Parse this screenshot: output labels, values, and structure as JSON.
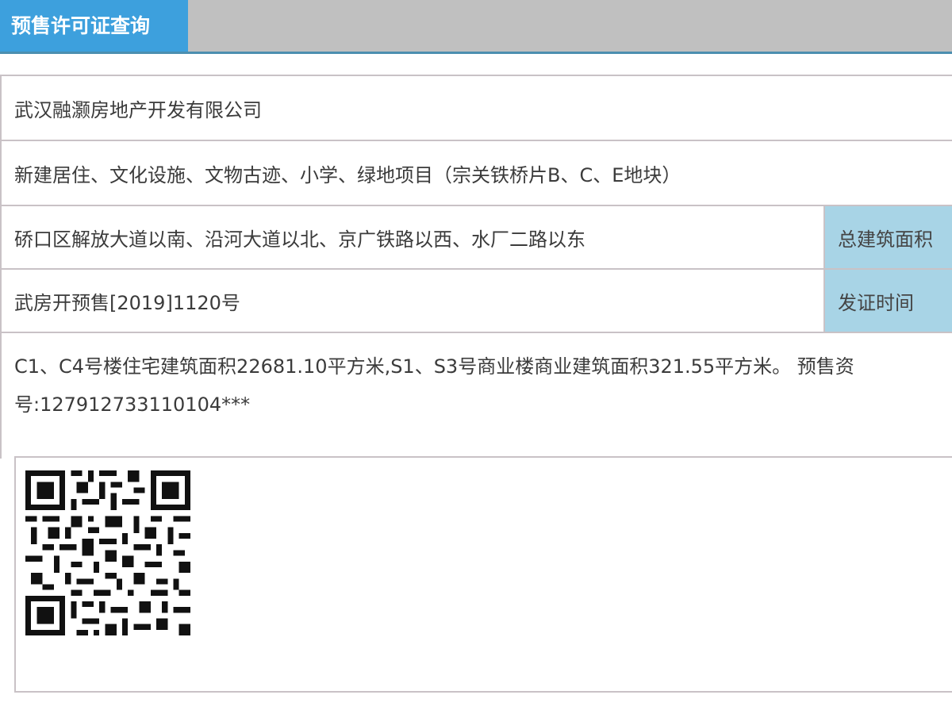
{
  "tab": {
    "title": "预售许可证查询"
  },
  "rows": {
    "company": "武汉融灏房地产开发有限公司",
    "project": "新建居住、文化设施、文物古迹、小学、绿地项目（宗关铁桥片B、C、E地块）",
    "location": "硚口区解放大道以南、沿河大道以北、京广铁路以西、水厂二路以东",
    "area_label": "总建筑面积",
    "permit_no": "武房开预售[2019]1120号",
    "issue_label": "发证时间",
    "remarks_line1": "C1、C4号楼住宅建筑面积22681.10平方米,S1、S3号商业楼商业建筑面积321.55平方米。 预售资",
    "remarks_line2": "号:127912733110104***"
  },
  "qr": {
    "icon": "qr-code-icon"
  }
}
